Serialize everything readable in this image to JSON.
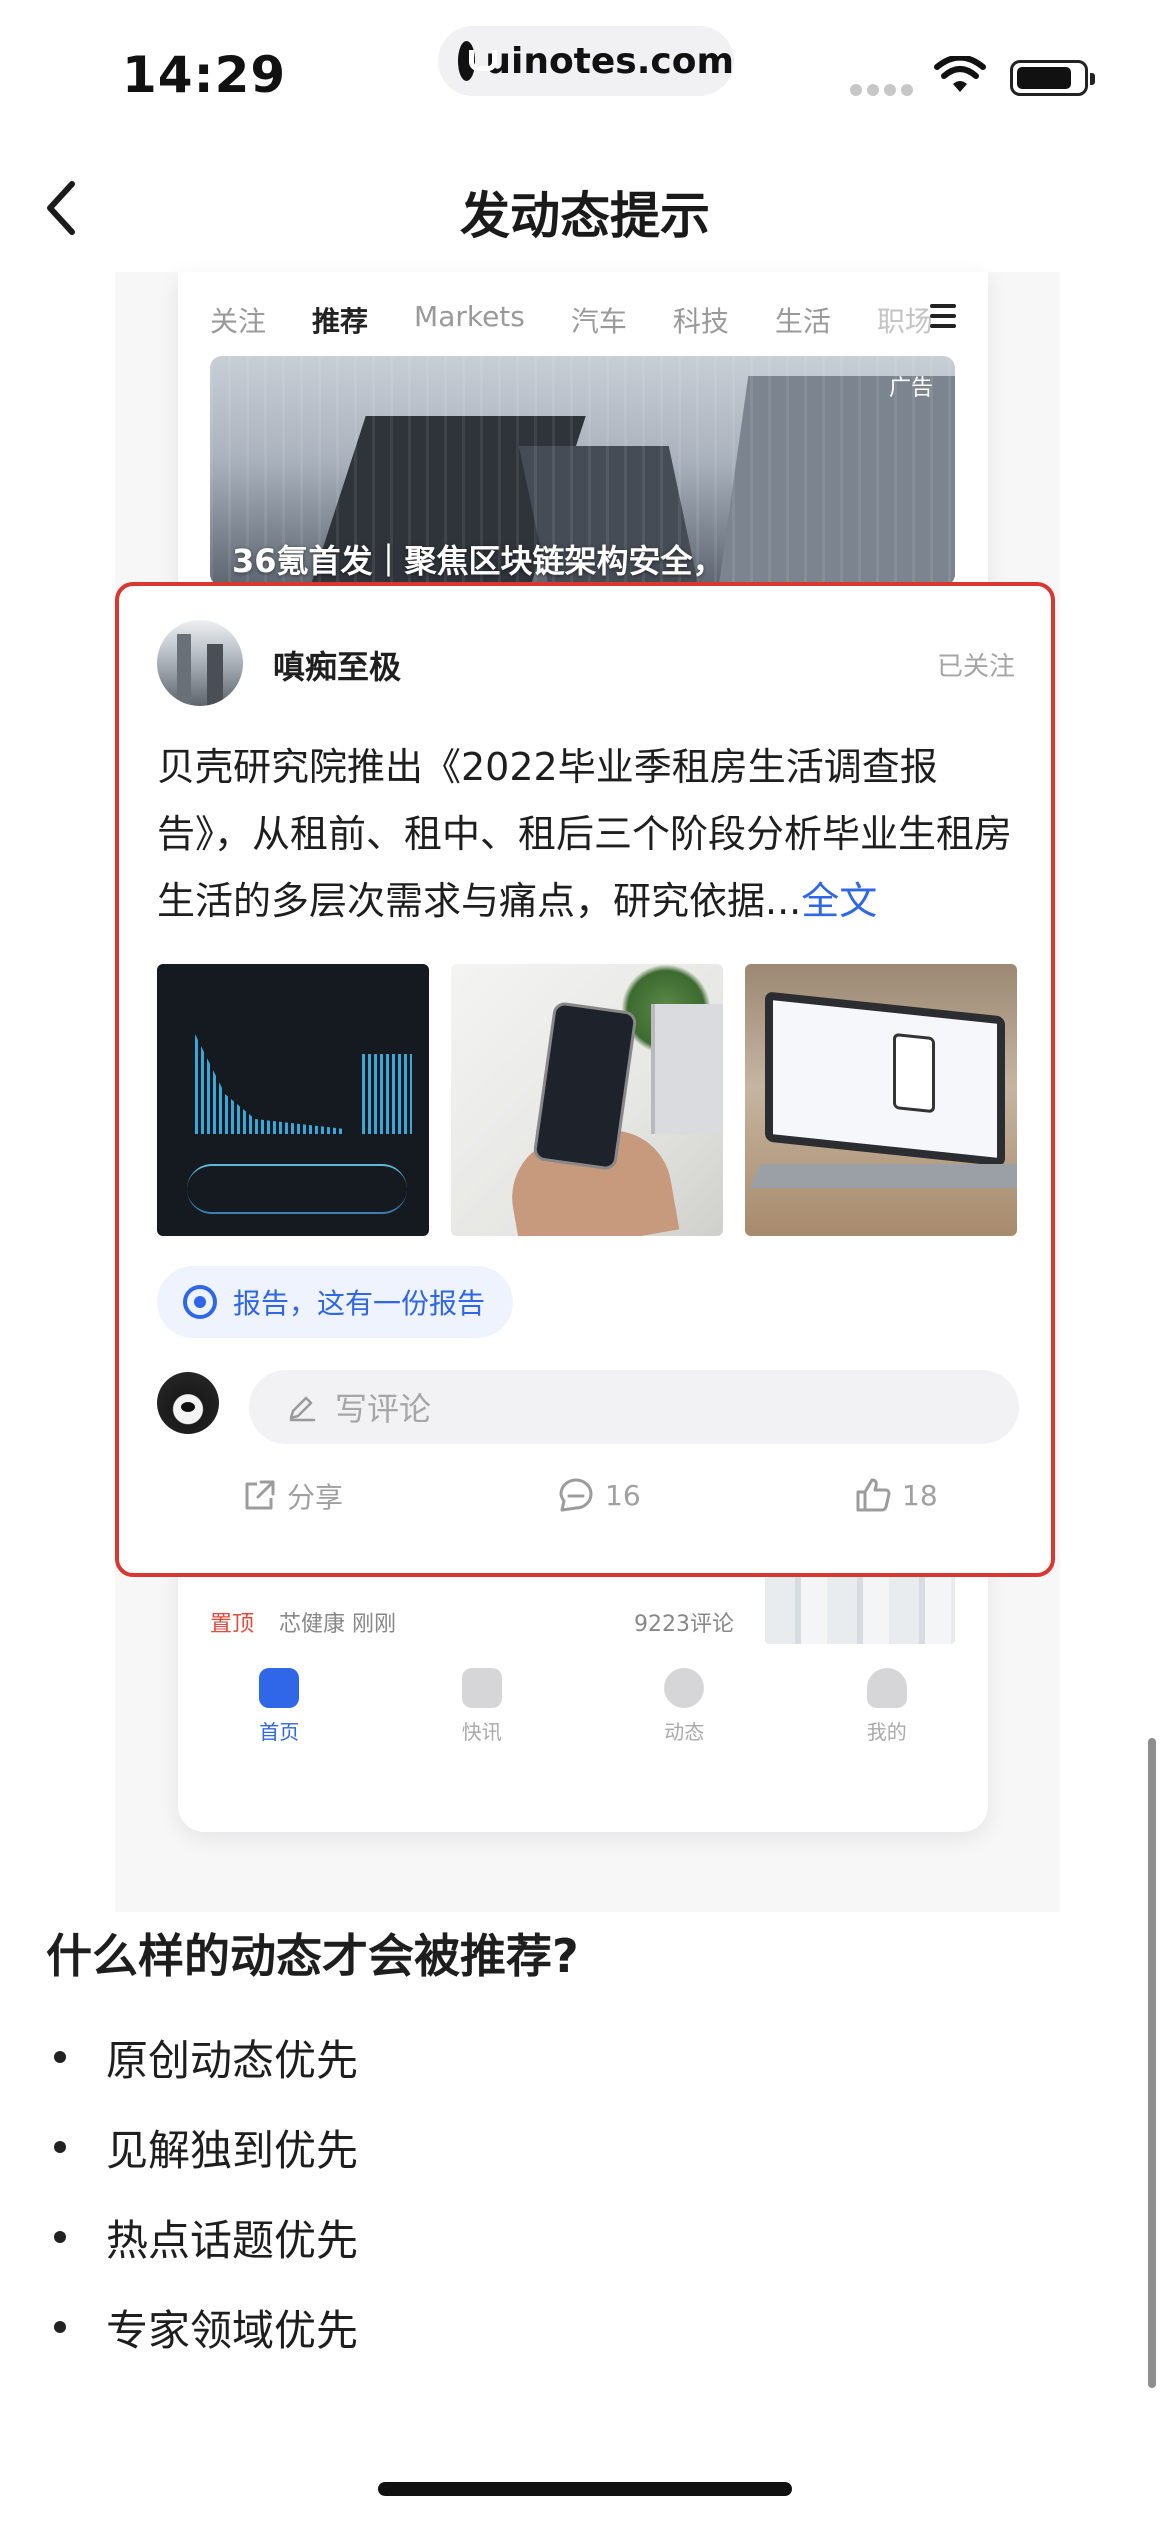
{
  "status_bar": {
    "time": "14:29",
    "url": "uinotes.com"
  },
  "nav": {
    "title": "发动态提示"
  },
  "feed_preview": {
    "tabs": [
      "关注",
      "推荐",
      "Markets",
      "汽车",
      "科技",
      "生活",
      "职场"
    ],
    "active_tab": "推荐",
    "ad_label": "广告",
    "headline": "36氪首发｜聚焦区块链架构安全，",
    "bottom_tags": {
      "hot": "置顶",
      "other": "芯健康 刚刚",
      "count": "9223评论"
    },
    "tabbar": [
      {
        "label": "首页",
        "icon": "home-icon",
        "active": true
      },
      {
        "label": "快讯",
        "icon": "flash-icon",
        "active": false
      },
      {
        "label": "动态",
        "icon": "moments-icon",
        "active": false
      },
      {
        "label": "我的",
        "icon": "profile-icon",
        "active": false
      }
    ]
  },
  "post": {
    "username": "嗔痴至极",
    "follow_status": "已关注",
    "text": "贝壳研究院推出《2022毕业季租房生活调查报告》，从租前、租中、租后三个阶段分析毕业生租房生活的多层次需求与痛点，研究依据...",
    "more_link": "全文",
    "topic": "报告，这有一份报告",
    "comment_placeholder": "写评论",
    "share_label": "分享",
    "comment_count": "16",
    "like_count": "18"
  },
  "rules": {
    "title": "什么样的动态才会被推荐?",
    "items": [
      "原创动态优先",
      "见解独到优先",
      "热点话题优先",
      "专家领域优先"
    ]
  },
  "colors": {
    "accent": "#2f67e8",
    "highlight_border": "#d9372f"
  }
}
